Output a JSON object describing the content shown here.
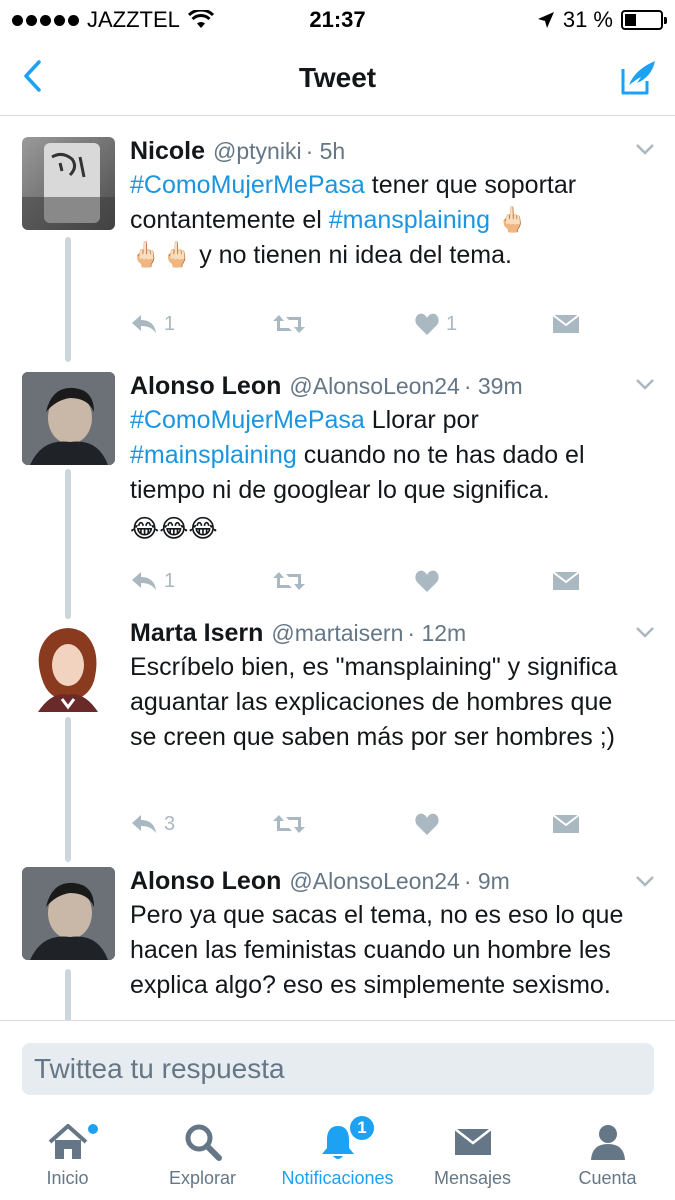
{
  "status_bar": {
    "carrier": "JAZZTEL",
    "time": "21:37",
    "battery": "31 %",
    "battery_level": 0.31
  },
  "nav": {
    "title": "Tweet",
    "back_icon": "back-chevron-icon",
    "compose_icon": "compose-tweet-icon"
  },
  "tweets": [
    {
      "name": "Nicole",
      "handle": "@ptyniki",
      "time": "· 5h",
      "text_parts": [
        "#ComoMujerMePasa",
        " tener que soportar contantemente el ",
        "#mansplaining",
        " ",
        "y no tienen ni idea del tema."
      ],
      "emojis_inline": "🖕🏻",
      "emojis_start": "🖕🏻🖕🏻",
      "replies": "1",
      "retweets": "",
      "likes": "1"
    },
    {
      "name": "Alonso Leon",
      "handle": "@AlonsoLeon24",
      "time": "· 39m",
      "text_parts": [
        "#ComoMujerMePasa",
        " Llorar por ",
        "#mainsplaining",
        " cuando no te has dado el tiempo ni de googlear lo que significa."
      ],
      "emojis": "😂😂😂",
      "replies": "1",
      "retweets": "",
      "likes": ""
    },
    {
      "name": "Marta Isern",
      "handle": "@martaisern",
      "time": "· 12m",
      "text": "Escríbelo bien, es \"mansplaining\" y significa aguantar las explicaciones de hombres que se creen que saben más por ser hombres ;)",
      "replies": "3",
      "retweets": "",
      "likes": ""
    },
    {
      "name": "Alonso Leon",
      "handle": "@AlonsoLeon24",
      "time": "· 9m",
      "text": "Pero ya que sacas el tema, no es eso lo que hacen las feministas cuando un hombre les explica algo? eso es simplemente sexismo."
    }
  ],
  "reply_box": {
    "placeholder": "Twittea tu respuesta"
  },
  "tabs": [
    {
      "label": "Inicio",
      "icon": "home-icon"
    },
    {
      "label": "Explorar",
      "icon": "search-icon"
    },
    {
      "label": "Notificaciones",
      "icon": "bell-icon",
      "badge": "1"
    },
    {
      "label": "Mensajes",
      "icon": "envelope-icon"
    },
    {
      "label": "Cuenta",
      "icon": "person-icon"
    }
  ],
  "colors": {
    "accent": "#1da1f2",
    "hashtag": "#1b95e0",
    "muted": "#657786",
    "action_gray": "#aab8c2"
  }
}
